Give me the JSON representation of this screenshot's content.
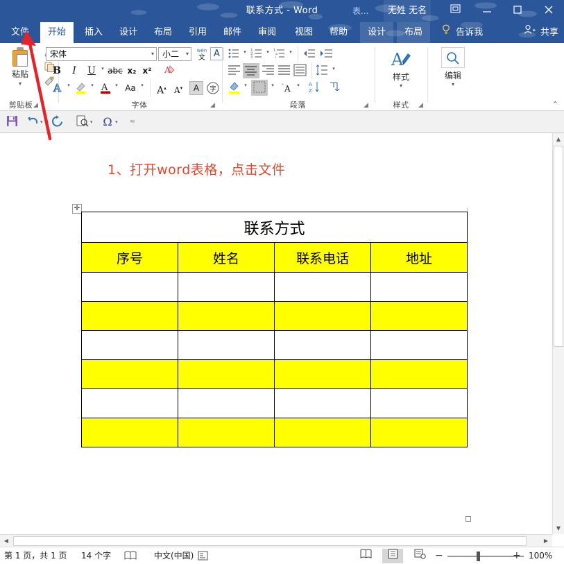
{
  "window": {
    "title": "联系方式  -  Word",
    "account_hint": "表...",
    "account_name": "无姓 无名",
    "ribbon_display_icon": "ribbon-display-options-icon",
    "minimize_icon": "minimize-icon",
    "maximize_icon": "maximize-icon",
    "close_icon": "close-icon",
    "accent_color": "#2b579a"
  },
  "tabs": [
    {
      "label": "文件",
      "state": "file"
    },
    {
      "label": "开始",
      "state": "active"
    },
    {
      "label": "插入",
      "state": "normal"
    },
    {
      "label": "设计",
      "state": "normal"
    },
    {
      "label": "布局",
      "state": "normal"
    },
    {
      "label": "引用",
      "state": "normal"
    },
    {
      "label": "邮件",
      "state": "normal"
    },
    {
      "label": "审阅",
      "state": "normal"
    },
    {
      "label": "视图",
      "state": "normal"
    },
    {
      "label": "帮助",
      "state": "normal"
    },
    {
      "label": "设计",
      "state": "tools"
    },
    {
      "label": "布局",
      "state": "tools"
    }
  ],
  "tell_me": {
    "label": "告诉我",
    "icon": "lightbulb-icon"
  },
  "share": {
    "label": "共享",
    "icon": "person-add-icon"
  },
  "ribbon": {
    "collapse_icon": "chevron-up-icon",
    "groups": [
      {
        "name": "剪贴板",
        "launcher": "dialog-launcher-icon"
      },
      {
        "name": "字体",
        "launcher": "dialog-launcher-icon"
      },
      {
        "name": "段落",
        "launcher": "dialog-launcher-icon"
      },
      {
        "name": "样式",
        "launcher": "dialog-launcher-icon"
      }
    ],
    "clipboard": {
      "paste_label": "粘贴",
      "paste_icon": "paste-icon",
      "cut_icon": "scissors-icon",
      "copy_icon": "copy-icon",
      "format_painter_icon": "format-painter-icon"
    },
    "font": {
      "font_name": "宋体",
      "font_size": "小二",
      "phonetic_icon": "phonetic-guide-icon",
      "char_border_icon": "character-border-icon",
      "bold": "B",
      "italic": "I",
      "underline": "U",
      "strikethrough_icon": "strikethrough-icon",
      "subscript_icon": "subscript-icon",
      "superscript_icon": "superscript-icon",
      "clear_format_icon": "clear-formatting-icon",
      "text_effects_icon": "text-effects-icon",
      "highlight_icon": "text-highlight-icon",
      "font_color_icon": "font-color-icon",
      "change_case_icon": "change-case-icon",
      "grow_font_icon": "grow-font-icon",
      "shrink_font_icon": "shrink-font-icon",
      "shading_icon": "character-shading-icon",
      "enclose_icon": "enclose-character-icon"
    },
    "paragraph": {
      "bullets_icon": "bullet-list-icon",
      "numbering_icon": "numbered-list-icon",
      "multilevel_icon": "multilevel-list-icon",
      "decrease_indent_icon": "decrease-indent-icon",
      "increase_indent_icon": "increase-indent-icon",
      "align_left_icon": "align-left-icon",
      "align_center_icon": "align-center-icon",
      "align_right_icon": "align-right-icon",
      "justify_icon": "justify-icon",
      "distribute_icon": "distribute-icon",
      "line_spacing_icon": "line-spacing-icon",
      "shading_icon": "paragraph-shading-icon",
      "borders_icon": "borders-icon",
      "asian_layout_icon": "asian-layout-icon",
      "sort_icon": "sort-icon",
      "show_marks_icon": "show-formatting-marks-icon"
    },
    "styles": {
      "label": "样式",
      "icon": "styles-icon",
      "caret": "▾"
    },
    "editing": {
      "label": "编辑",
      "icon": "find-icon",
      "caret": "▾"
    }
  },
  "quick_toolbar": {
    "save_icon": "save-icon",
    "undo_icon": "undo-icon",
    "redo_icon": "redo-icon",
    "print_preview_icon": "print-preview-icon",
    "symbol_icon": "symbol-omega-icon",
    "more_icon": "more-commands-icon"
  },
  "document": {
    "annotation": "1、打开word表格，点击文件",
    "annotation_color": "#e1472e",
    "move_handle_icon": "table-move-handle-icon",
    "resize_handle_icon": "table-resize-handle-icon",
    "table": {
      "title": "联系方式",
      "headers": [
        "序号",
        "姓名",
        "联系电话",
        "地址"
      ],
      "header_fill": "#ffff00",
      "rows": [
        {
          "fill": "white",
          "cells": [
            "",
            "",
            "",
            ""
          ]
        },
        {
          "fill": "yellow",
          "cells": [
            "",
            "",
            "",
            ""
          ]
        },
        {
          "fill": "white",
          "cells": [
            "",
            "",
            "",
            ""
          ]
        },
        {
          "fill": "yellow",
          "cells": [
            "",
            "",
            "",
            ""
          ]
        },
        {
          "fill": "white",
          "cells": [
            "",
            "",
            "",
            ""
          ]
        },
        {
          "fill": "yellow",
          "cells": [
            "",
            "",
            "",
            ""
          ]
        }
      ]
    }
  },
  "scrollbars": {
    "v_up_icon": "scroll-up-icon",
    "v_down_icon": "scroll-down-icon",
    "h_left_icon": "scroll-left-icon",
    "h_right_icon": "scroll-right-icon"
  },
  "status_bar": {
    "page_info": "第 1 页，共 1 页",
    "word_count": "14 个字",
    "proofing_icon": "proofing-errors-icon",
    "language": "中文(中国)",
    "accessibility_icon": "accessibility-icon",
    "view_read_icon": "read-mode-icon",
    "view_print_icon": "print-layout-icon",
    "view_web_icon": "web-layout-icon",
    "zoom_out": "−",
    "zoom_in": "+",
    "zoom_level": "100%"
  }
}
